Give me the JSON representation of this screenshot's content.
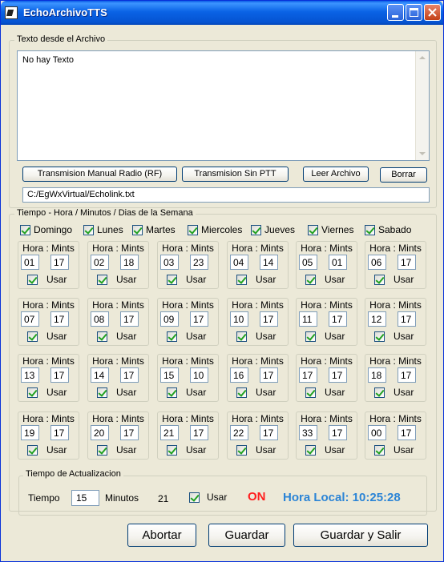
{
  "window": {
    "title": "EchoArchivoTTS"
  },
  "texto_group": {
    "legend": "Texto desde el Archivo",
    "memo_text": "No hay Texto",
    "btn_rf": "Transmision Manual Radio (RF)",
    "btn_sin_ptt": "Transmision Sin PTT",
    "btn_leer": "Leer Archivo",
    "btn_borrar": "Borrar",
    "file_path": "C:/EgWxVirtual/Echolink.txt"
  },
  "tiempo_group": {
    "legend": "Tiempo - Hora / Minutos / Dias de la Semana",
    "days": [
      {
        "label": "Domingo",
        "checked": true
      },
      {
        "label": "Lunes",
        "checked": true
      },
      {
        "label": "Martes",
        "checked": true
      },
      {
        "label": "Miercoles",
        "checked": true
      },
      {
        "label": "Jueves",
        "checked": true
      },
      {
        "label": "Viernes",
        "checked": true
      },
      {
        "label": "Sabado",
        "checked": true
      }
    ],
    "slot_header": "Hora : Mints",
    "slot_usar": "Usar",
    "slots": [
      {
        "hour": "01",
        "min": "17",
        "usar": true
      },
      {
        "hour": "02",
        "min": "18",
        "usar": true
      },
      {
        "hour": "03",
        "min": "23",
        "usar": true
      },
      {
        "hour": "04",
        "min": "14",
        "usar": true
      },
      {
        "hour": "05",
        "min": "01",
        "usar": true
      },
      {
        "hour": "06",
        "min": "17",
        "usar": true
      },
      {
        "hour": "07",
        "min": "17",
        "usar": true
      },
      {
        "hour": "08",
        "min": "17",
        "usar": true
      },
      {
        "hour": "09",
        "min": "17",
        "usar": true
      },
      {
        "hour": "10",
        "min": "17",
        "usar": true
      },
      {
        "hour": "11",
        "min": "17",
        "usar": true
      },
      {
        "hour": "12",
        "min": "17",
        "usar": true
      },
      {
        "hour": "13",
        "min": "17",
        "usar": true
      },
      {
        "hour": "14",
        "min": "17",
        "usar": true
      },
      {
        "hour": "15",
        "min": "10",
        "usar": true
      },
      {
        "hour": "16",
        "min": "17",
        "usar": true
      },
      {
        "hour": "17",
        "min": "17",
        "usar": true
      },
      {
        "hour": "18",
        "min": "17",
        "usar": true
      },
      {
        "hour": "19",
        "min": "17",
        "usar": true
      },
      {
        "hour": "20",
        "min": "17",
        "usar": true
      },
      {
        "hour": "21",
        "min": "17",
        "usar": true
      },
      {
        "hour": "22",
        "min": "17",
        "usar": true
      },
      {
        "hour": "33",
        "min": "17",
        "usar": true
      },
      {
        "hour": "00",
        "min": "17",
        "usar": true
      }
    ]
  },
  "actualizacion_group": {
    "legend": "Tiempo de Actualizacion",
    "tiempo_label": "Tiempo",
    "tiempo_value": "15",
    "minutos_label": "Minutos",
    "counter": "21",
    "usar_label": "Usar",
    "usar_checked": true,
    "status": "ON",
    "hora_local": "Hora Local: 10:25:28"
  },
  "footer": {
    "abortar": "Abortar",
    "guardar": "Guardar",
    "guardar_salir": "Guardar y Salir"
  },
  "colors": {
    "on": "#ff1d1d",
    "hora_local": "#2b84d6",
    "title_bar": "#0a63e6"
  }
}
